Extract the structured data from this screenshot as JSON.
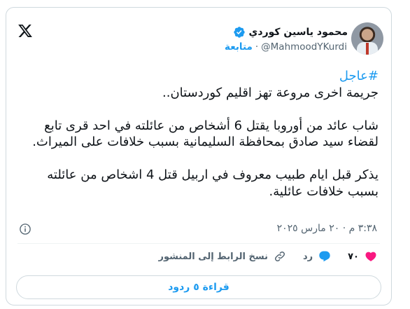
{
  "author": {
    "name": "محمود ياسين كوردي",
    "handle": "@MahmoodYKurdi",
    "separator": "·",
    "follow_label": "متابعة"
  },
  "tweet": {
    "hashtag": "#عاجل",
    "line1": "جريمة اخرى مروعة تهز اقليم كوردستان..",
    "paragraph2": "شاب عائد من أوروبا يقتل 6 أشخاص من عائلته في احد قرى تابع لقضاء سيد صادق بمحافظة السليمانية بسبب خلافات على الميراث.",
    "paragraph3": "يذكر قبل ايام طبيب معروف في اربيل قتل 4 اشخاص من عائلته بسبب خلافات عائلية.",
    "timestamp": "٣:٣٨ م · ٢٠ مارس ٢٠٢٥"
  },
  "actions": {
    "likes_count": "٧٠",
    "reply_label": "رد",
    "copy_link_label": "نسخ الرابط إلى المنشور"
  },
  "read_replies_label": "قراءة ٥ ردود",
  "colors": {
    "accent": "#1d9bf0",
    "like": "#f91880",
    "muted": "#536471",
    "text": "#0f1419"
  },
  "icons": [
    "x-logo-icon",
    "verified-badge-icon",
    "info-icon",
    "heart-icon",
    "reply-icon",
    "link-icon"
  ]
}
